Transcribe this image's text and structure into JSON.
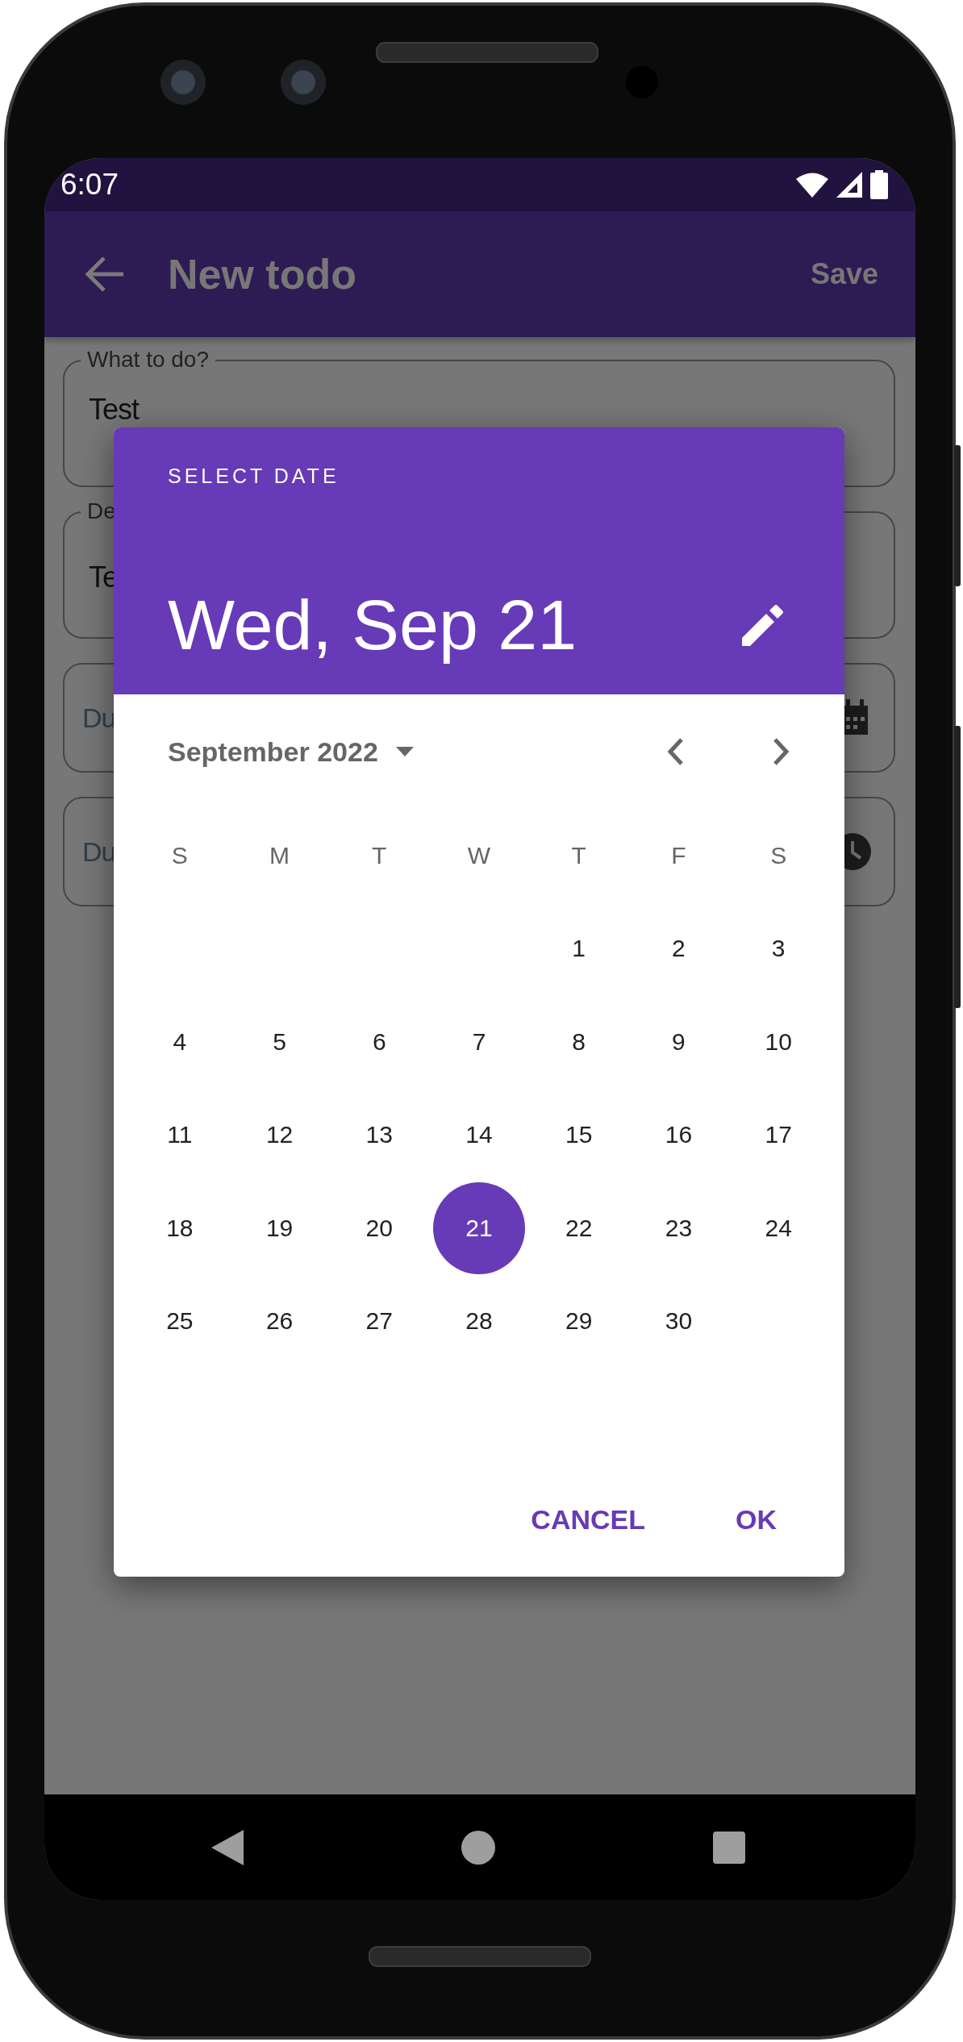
{
  "status_bar": {
    "time": "6:07"
  },
  "app_bar": {
    "title": "New todo",
    "action": "Save"
  },
  "form": {
    "fields": [
      {
        "kind": "text",
        "label": "What to do?",
        "value": "Test"
      },
      {
        "kind": "text",
        "label": "De",
        "value": "Te"
      },
      {
        "kind": "date",
        "placeholder": "Du"
      },
      {
        "kind": "time",
        "placeholder": "Du"
      }
    ]
  },
  "date_picker": {
    "header_label": "SELECT DATE",
    "selected_date": "Wed, Sep 21",
    "month": "September 2022",
    "weekdays": [
      "S",
      "M",
      "T",
      "W",
      "T",
      "F",
      "S"
    ],
    "weeks": [
      [
        {
          "kind": "blank"
        },
        {
          "kind": "blank"
        },
        {
          "kind": "blank"
        },
        {
          "kind": "blank"
        },
        {
          "day": "1",
          "selected": false
        },
        {
          "day": "2",
          "selected": false
        },
        {
          "day": "3",
          "selected": false
        }
      ],
      [
        {
          "day": "4",
          "selected": false
        },
        {
          "day": "5",
          "selected": false
        },
        {
          "day": "6",
          "selected": false
        },
        {
          "day": "7",
          "selected": false
        },
        {
          "day": "8",
          "selected": false
        },
        {
          "day": "9",
          "selected": false
        },
        {
          "day": "10",
          "selected": false
        }
      ],
      [
        {
          "day": "11",
          "selected": false
        },
        {
          "day": "12",
          "selected": false
        },
        {
          "day": "13",
          "selected": false
        },
        {
          "day": "14",
          "selected": false
        },
        {
          "day": "15",
          "selected": false
        },
        {
          "day": "16",
          "selected": false
        },
        {
          "day": "17",
          "selected": false
        }
      ],
      [
        {
          "day": "18",
          "selected": false
        },
        {
          "day": "19",
          "selected": false
        },
        {
          "day": "20",
          "selected": false
        },
        {
          "day": "21",
          "selected": true
        },
        {
          "day": "22",
          "selected": false
        },
        {
          "day": "23",
          "selected": false
        },
        {
          "day": "24",
          "selected": false
        }
      ],
      [
        {
          "day": "25",
          "selected": false
        },
        {
          "day": "26",
          "selected": false
        },
        {
          "day": "27",
          "selected": false
        },
        {
          "day": "28",
          "selected": false
        },
        {
          "day": "29",
          "selected": false
        },
        {
          "day": "30",
          "selected": false
        },
        {
          "kind": "blank"
        }
      ]
    ],
    "buttons": [
      "CANCEL",
      "OK"
    ]
  }
}
